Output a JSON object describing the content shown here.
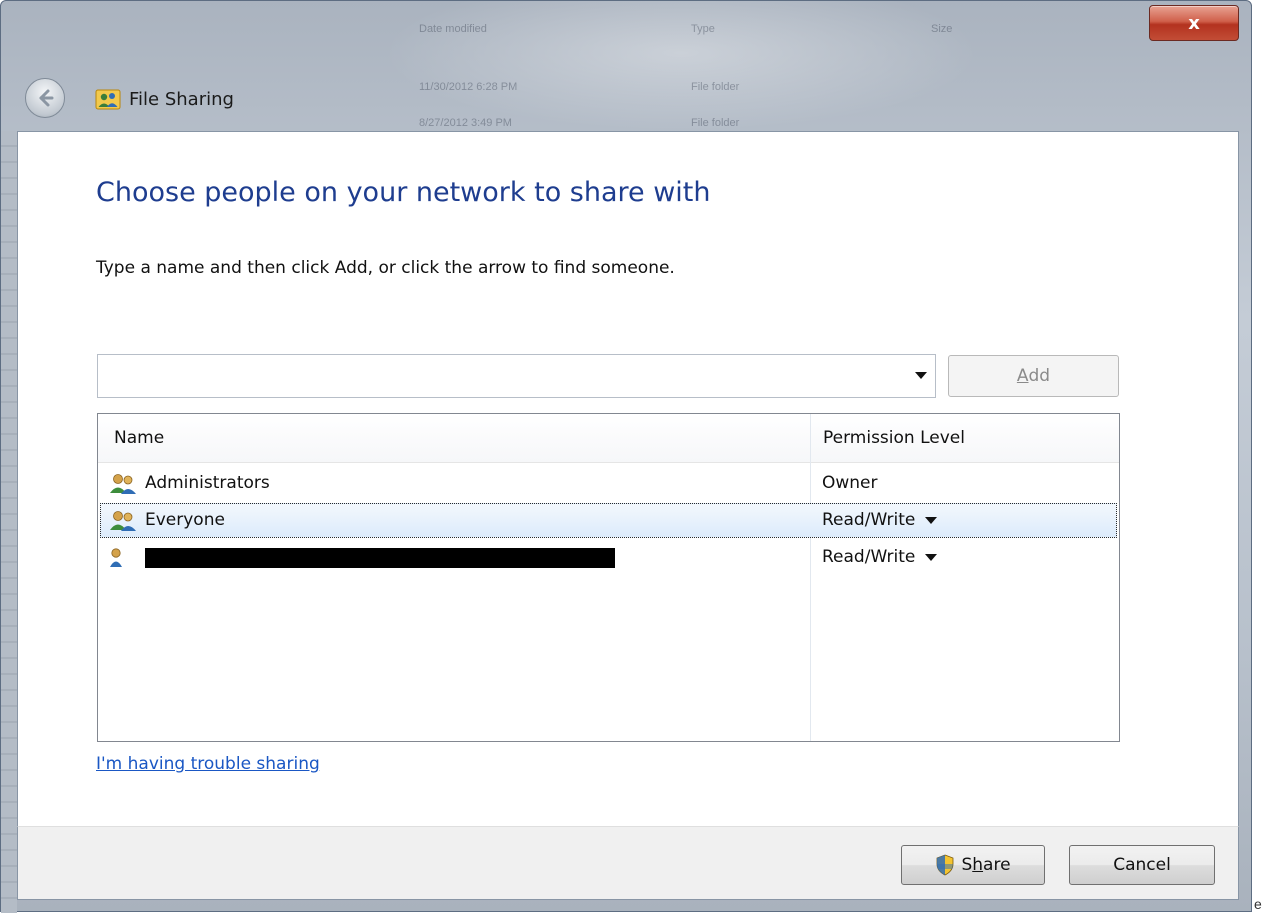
{
  "background_hint": {
    "header_fragments": [
      "Date modified",
      "Type",
      "Size"
    ],
    "row_fragments": [
      {
        "date": "11/30/2012 6:28 PM",
        "type": "File folder"
      },
      {
        "date": "8/27/2012 3:49 PM",
        "type": "File folder"
      }
    ]
  },
  "window": {
    "title": "File Sharing",
    "close_label": "x"
  },
  "dialog": {
    "heading": "Choose people on your network to share with",
    "instructions": "Type a name and then click Add, or click the arrow to find someone.",
    "name_input_value": "",
    "add_button": {
      "mnemonic": "A",
      "rest": "dd"
    },
    "table": {
      "columns": [
        "Name",
        "Permission Level"
      ],
      "rows": [
        {
          "name": "Administrators",
          "permission": "Owner",
          "icon": "group-users-icon",
          "has_dropdown": false,
          "selected": false,
          "redacted": false
        },
        {
          "name": "Everyone",
          "permission": "Read/Write",
          "icon": "group-users-icon",
          "has_dropdown": true,
          "selected": true,
          "redacted": false
        },
        {
          "name": "",
          "permission": "Read/Write",
          "icon": "single-user-icon",
          "has_dropdown": true,
          "selected": false,
          "redacted": true
        }
      ]
    },
    "trouble_link": "I'm having trouble sharing",
    "share_button": {
      "pre": "S",
      "mnemonic": "h",
      "post": "are"
    },
    "cancel_button": "Cancel"
  },
  "edge_fragment": "e",
  "colors": {
    "heading": "#1e3d8f",
    "link": "#1a57c4",
    "close_button": "#c24d36",
    "selection": "#dcebfb"
  }
}
